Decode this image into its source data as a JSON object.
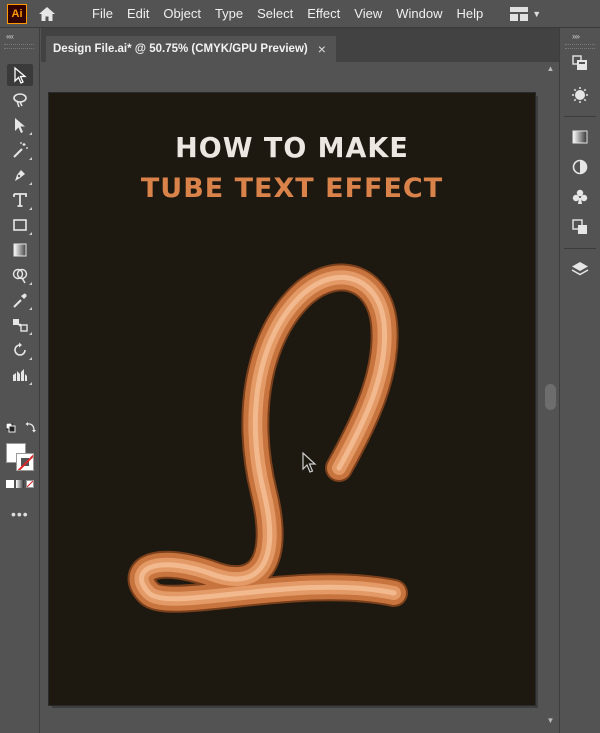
{
  "app": {
    "logo_text": "Ai",
    "home_icon": "home-icon"
  },
  "menu": {
    "items": [
      "File",
      "Edit",
      "Object",
      "Type",
      "Select",
      "Effect",
      "View",
      "Window",
      "Help"
    ],
    "workspace_icon": "workspace-layout-icon"
  },
  "document": {
    "tab_title": "Design File.ai* @ 50.75% (CMYK/GPU Preview)",
    "close_glyph": "×"
  },
  "artwork": {
    "headline_line1": "HOW TO MAKE",
    "headline_line2": "TUBE TEXT EFFECT",
    "tube_color": "#d9824a",
    "background_color": "#1d1910"
  },
  "toolbar": {
    "collapse_glyph": "««",
    "tools": [
      "selection-tool-icon",
      "curvature-lasso-icon",
      "direct-selection-icon",
      "magic-wand-icon",
      "pen-tool-icon",
      "type-tool-icon",
      "rectangle-tool-icon",
      "gradient-tool-icon",
      "shape-builder-icon",
      "eyedropper-icon",
      "blend-tool-icon",
      "rotate-tool-icon",
      "column-graph-icon"
    ],
    "more_glyph": "•••"
  },
  "dock": {
    "collapse_glyph": "»»",
    "panels": [
      "libraries-icon",
      "color-wheel-icon",
      "gradient-panel-icon",
      "appearance-icon",
      "symbols-icon",
      "pathfinder-icon",
      "layers-icon"
    ]
  },
  "scrollbar": {
    "up_glyph": "▲",
    "down_glyph": "▼"
  }
}
